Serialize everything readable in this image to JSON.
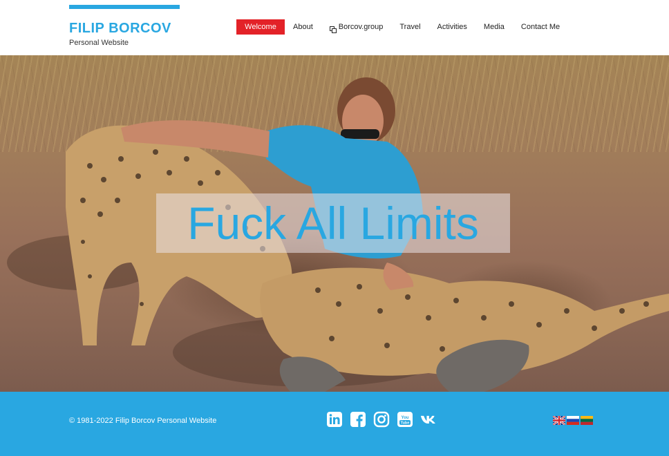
{
  "brand": {
    "title": "FILIP BORCOV",
    "subtitle": "Personal Website",
    "accent_color": "#29a7e1"
  },
  "nav": {
    "items": [
      {
        "label": "Welcome",
        "active": true
      },
      {
        "label": "About"
      },
      {
        "label": "Borcov.group",
        "icon": "external-link-icon"
      },
      {
        "label": "Travel"
      },
      {
        "label": "Activities"
      },
      {
        "label": "Media"
      },
      {
        "label": "Contact Me"
      }
    ],
    "active_color": "#e32228"
  },
  "hero": {
    "caption": "Fuck All Limits"
  },
  "footer": {
    "copyright": "© 1981-2022 Filip Borcov Personal Website",
    "background_color": "#29a7e1",
    "social": [
      "linkedin-icon",
      "facebook-icon",
      "instagram-icon",
      "youtube-icon",
      "vk-icon"
    ],
    "languages": [
      "english-flag-icon",
      "russian-flag-icon",
      "lithuanian-flag-icon"
    ]
  }
}
